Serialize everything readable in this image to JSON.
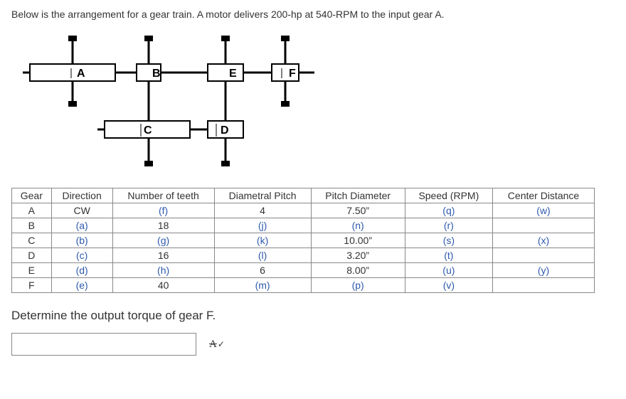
{
  "problem_text": "Below is the arrangement for a gear train.  A motor delivers 200-hp at 540-RPM to the input gear A.",
  "diagram": {
    "labels": {
      "A": "A",
      "B": "B",
      "C": "C",
      "D": "D",
      "E": "E",
      "F": "F"
    }
  },
  "table": {
    "headers": [
      "Gear",
      "Direction",
      "Number of teeth",
      "Diametral Pitch",
      "Pitch Diameter",
      "Speed (RPM)",
      "Center Distance"
    ],
    "rows": [
      {
        "gear": "A",
        "dir": "CW",
        "teeth": "(f)",
        "dp": "4",
        "pd": "7.50”",
        "rpm": "(q)",
        "cd": "(w)",
        "blue": {
          "teeth": true,
          "rpm": true,
          "cd": true
        }
      },
      {
        "gear": "B",
        "dir": "(a)",
        "teeth": "18",
        "dp": "(j)",
        "pd": "(n)",
        "rpm": "(r)",
        "cd": "",
        "blue": {
          "dir": true,
          "dp": true,
          "pd": true,
          "rpm": true
        }
      },
      {
        "gear": "C",
        "dir": "(b)",
        "teeth": "(g)",
        "dp": "(k)",
        "pd": "10.00”",
        "rpm": "(s)",
        "cd": "(x)",
        "blue": {
          "dir": true,
          "teeth": true,
          "dp": true,
          "rpm": true,
          "cd": true
        }
      },
      {
        "gear": "D",
        "dir": "(c)",
        "teeth": "16",
        "dp": "(l)",
        "pd": "3.20”",
        "rpm": "(t)",
        "cd": "",
        "blue": {
          "dir": true,
          "dp": true,
          "rpm": true
        }
      },
      {
        "gear": "E",
        "dir": "(d)",
        "teeth": "(h)",
        "dp": "6",
        "pd": "8.00”",
        "rpm": "(u)",
        "cd": "(y)",
        "blue": {
          "dir": true,
          "teeth": true,
          "rpm": true,
          "cd": true
        }
      },
      {
        "gear": "F",
        "dir": "(e)",
        "teeth": "40",
        "dp": "(m)",
        "pd": "(p)",
        "rpm": "(v)",
        "cd": "",
        "blue": {
          "dir": true,
          "dp": true,
          "pd": true,
          "rpm": true
        }
      }
    ]
  },
  "question": "Determine the output torque of gear F.",
  "answer_value": ""
}
